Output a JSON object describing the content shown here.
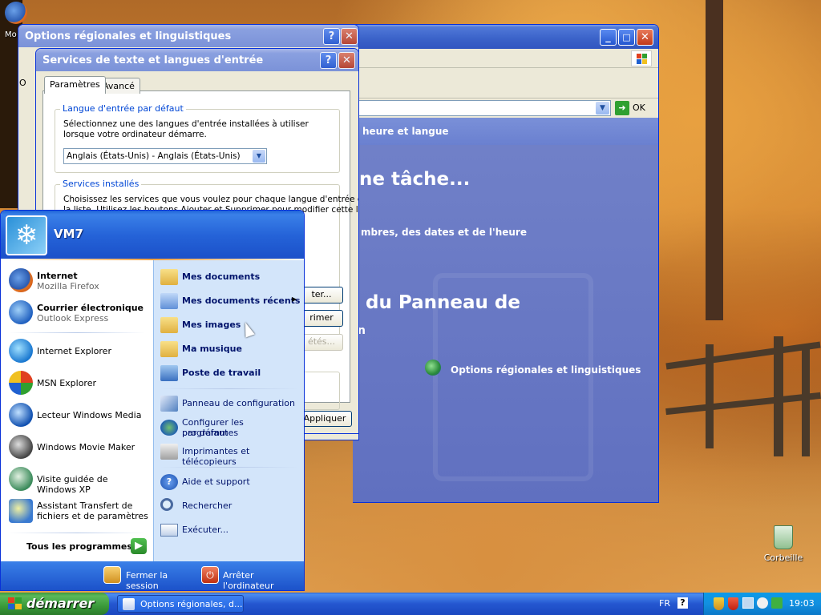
{
  "desktop": {
    "firefox_icon_label": "Mo",
    "recycle_bin_label": "Corbeille"
  },
  "regional_window": {
    "title": "Options régionales et linguistiques",
    "help": "?",
    "close": "✕"
  },
  "control_panel": {
    "go_label": "OK",
    "category_header": "heure et langue",
    "task_heading": "ne tâche...",
    "task_item": "mbres, des dates et de l'heure",
    "icon_heading": "du Panneau de",
    "icon_heading_tail": "n",
    "regional_icon_label": "Options régionales et linguistiques",
    "minimize": "_",
    "maximize": "□",
    "close": "✕"
  },
  "text_services_dialog": {
    "title": "Services de texte et langues d'entrée",
    "help": "?",
    "close": "✕",
    "tabs": [
      "Paramètres",
      "Avancé"
    ],
    "default_lang_group": "Langue d'entrée par défaut",
    "default_lang_desc": "Sélectionnez une des langues d'entrée installées à utiliser lorsque votre ordinateur démarre.",
    "default_lang_value": "Anglais (États-Unis) - Anglais (États-Unis)",
    "installed_group": "Services installés",
    "installed_desc_1": "Choisissez les services que vous voulez pour chaque langue d'entrée de",
    "installed_desc_2": "la liste. Utilisez les boutons Ajouter et Supprimer pour modifier cette liste.",
    "add_button": "ter...",
    "remove_button": "rimer",
    "properties_button": "étés...",
    "apply_button": "Appliquer"
  },
  "start_menu": {
    "user_name": "VM7",
    "pinned": [
      {
        "title": "Internet",
        "subtitle": "Mozilla Firefox",
        "icon": "firefox-icon"
      },
      {
        "title": "Courrier électronique",
        "subtitle": "Outlook Express",
        "icon": "outlook-icon"
      }
    ],
    "recent": [
      {
        "title": "Internet Explorer",
        "icon": "ie-icon"
      },
      {
        "title": "MSN Explorer",
        "icon": "msn-icon"
      },
      {
        "title": "Lecteur Windows Media",
        "icon": "media-player-icon"
      },
      {
        "title": "Windows Movie Maker",
        "icon": "movie-maker-icon"
      },
      {
        "title": "Visite guidée de Windows XP",
        "icon": "tour-icon"
      },
      {
        "title": "Assistant Transfert de fichiers et de paramètres",
        "title_line1": "Assistant Transfert de",
        "title_line2": "fichiers et de paramètres",
        "icon": "transfer-wizard-icon"
      }
    ],
    "all_programs": "Tous les programmes",
    "right_items": [
      {
        "title": "Mes documents",
        "icon": "my-documents-icon"
      },
      {
        "title": "Mes documents récents",
        "icon": "recent-documents-icon"
      },
      {
        "title": "Mes images",
        "icon": "my-pictures-icon"
      },
      {
        "title": "Ma musique",
        "icon": "my-music-icon"
      },
      {
        "title": "Poste de travail",
        "icon": "my-computer-icon"
      },
      {
        "title": "Panneau de configuration",
        "icon": "control-panel-icon"
      },
      {
        "title": "Configurer les programmes par défaut",
        "title_line1": "Configurer les programmes",
        "title_line2": "par défaut",
        "icon": "default-programs-icon"
      },
      {
        "title": "Imprimantes et télécopieurs",
        "icon": "printers-icon"
      },
      {
        "title": "Aide et support",
        "icon": "help-icon"
      },
      {
        "title": "Rechercher",
        "icon": "search-icon"
      },
      {
        "title": "Exécuter...",
        "icon": "run-icon"
      }
    ],
    "logoff": "Fermer la session",
    "shutdown": "Arrêter l'ordinateur"
  },
  "taskbar": {
    "start_label": "démarrer",
    "task_button": "Options régionales, d...",
    "language": "FR",
    "help_glyph": "?",
    "clock": "19:03"
  }
}
